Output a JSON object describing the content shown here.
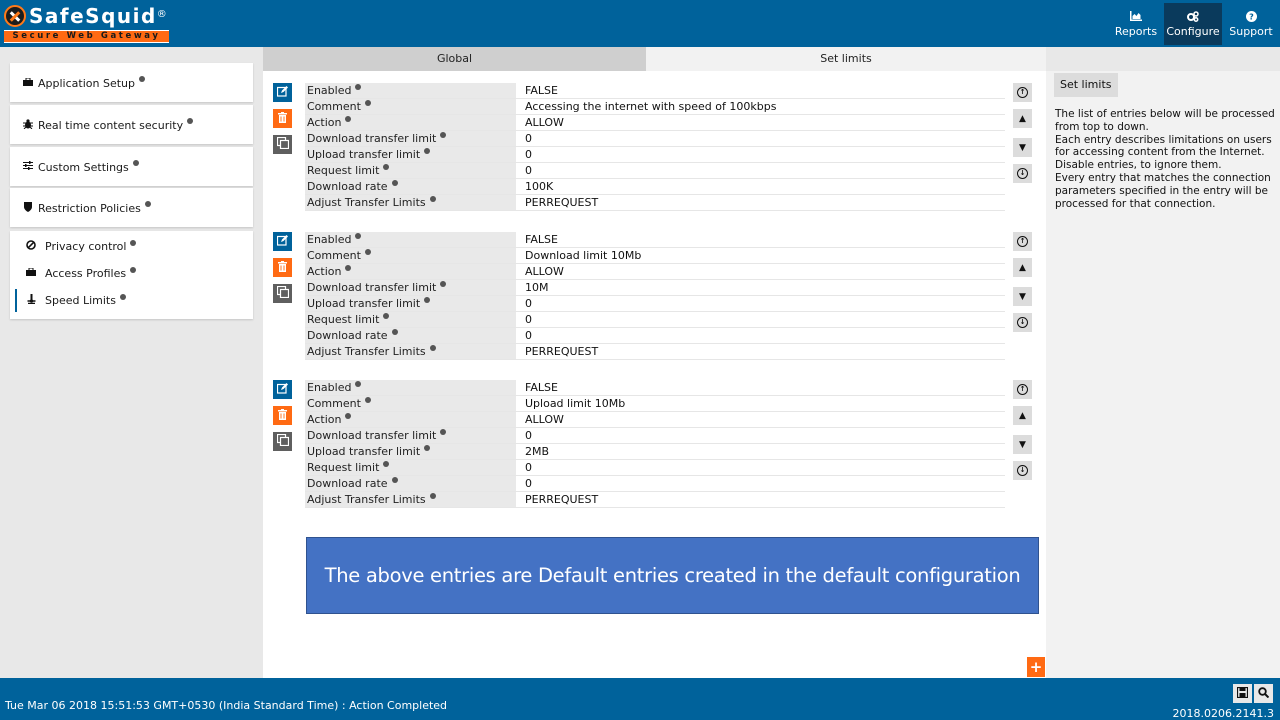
{
  "app": {
    "logo_text": "SafeSquid",
    "logo_reg": "®",
    "logo_subtitle": "Secure Web Gateway"
  },
  "nav": [
    {
      "label": "Reports",
      "icon": "area-chart-icon",
      "active": false
    },
    {
      "label": "Configure",
      "icon": "cogs-icon",
      "active": true
    },
    {
      "label": "Support",
      "icon": "question-circle-icon",
      "active": false
    }
  ],
  "sidebar": {
    "sections": [
      {
        "label": "Application Setup",
        "icon": "briefcase-icon"
      },
      {
        "label": "Real time content security",
        "icon": "bug-icon"
      },
      {
        "label": "Custom Settings",
        "icon": "sliders-icon"
      },
      {
        "label": "Restriction Policies",
        "icon": "shield-icon"
      }
    ],
    "subitems": [
      {
        "label": "Privacy control",
        "icon": "ban-icon",
        "active": false
      },
      {
        "label": "Access Profiles",
        "icon": "briefcase-icon",
        "active": false
      },
      {
        "label": "Speed Limits",
        "icon": "anchor-icon",
        "active": true
      }
    ]
  },
  "tabs": [
    {
      "label": "Global",
      "active": false
    },
    {
      "label": "Set limits",
      "active": true
    }
  ],
  "field_labels": [
    "Enabled",
    "Comment",
    "Action",
    "Download transfer limit",
    "Upload transfer limit",
    "Request limit",
    "Download rate",
    "Adjust Transfer Limits"
  ],
  "entries": [
    {
      "values": [
        "FALSE",
        "Accessing the internet with speed of 100kbps",
        "ALLOW",
        "0",
        "0",
        "0",
        "100K",
        "PERREQUEST"
      ]
    },
    {
      "values": [
        "FALSE",
        "Download limit 10Mb",
        "ALLOW",
        "10M",
        "0",
        "0",
        "0",
        "PERREQUEST"
      ]
    },
    {
      "values": [
        "FALSE",
        "Upload limit 10Mb",
        "ALLOW",
        "0",
        "2MB",
        "0",
        "0",
        "PERREQUEST"
      ]
    }
  ],
  "banner": "The above entries are Default entries created in the default configuration",
  "help": {
    "title": "Set limits",
    "text": "The list of entries below will be processed from top to down.\nEach entry describes limitations on users for accessing content from the Internet.\nDisable entries, to ignore them.\nEvery entry that matches the connection parameters specified in the entry will be processed for that connection."
  },
  "footer": {
    "status": "Tue Mar 06 2018 15:51:53 GMT+0530 (India Standard Time) : Action Completed",
    "version": "2018.0206.2141.3"
  },
  "colors": {
    "brand_blue": "#00629b",
    "accent_orange": "#ff6a13",
    "banner_blue": "#4472c4"
  }
}
